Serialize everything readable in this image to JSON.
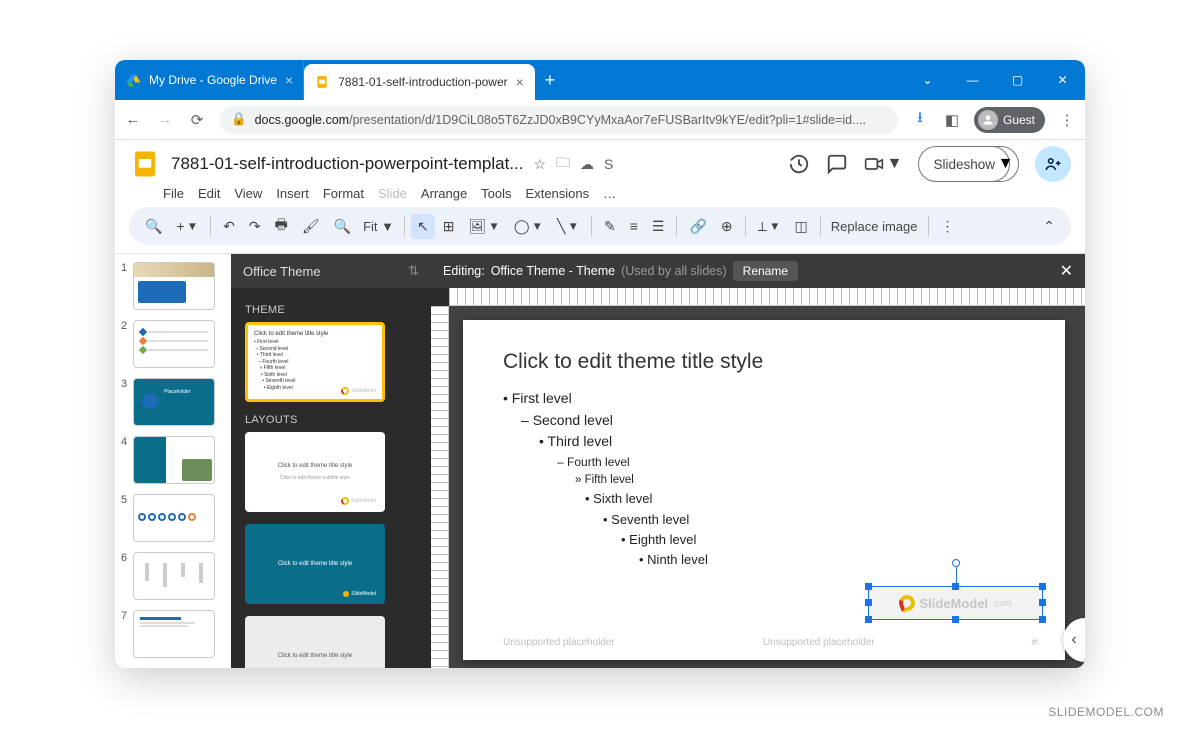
{
  "browser": {
    "tabs": [
      {
        "title": "My Drive - Google Drive",
        "favicon": "drive",
        "active": false
      },
      {
        "title": "7881-01-self-introduction-power",
        "favicon": "slides",
        "active": true
      }
    ],
    "url_host": "docs.google.com",
    "url_path": "/presentation/d/1D9CiL08o5T6ZzJD0xB9CYyMxaAor7eFUSBarItv9kYE/edit?pli=1#slide=id....",
    "guest_label": "Guest"
  },
  "app": {
    "doc_title": "7881-01-self-introduction-powerpoint-templat...",
    "s_badge": "S",
    "menus": [
      "File",
      "Edit",
      "View",
      "Insert",
      "Format",
      "Slide",
      "Arrange",
      "Tools",
      "Extensions",
      "…"
    ],
    "menu_disabled": [
      "Slide"
    ],
    "slideshow_label": "Slideshow",
    "zoom_label": "Fit",
    "replace_label": "Replace image"
  },
  "theme_panel": {
    "title": "Office Theme",
    "section_theme": "THEME",
    "section_layouts": "LAYOUTS"
  },
  "editor": {
    "prefix": "Editing:",
    "theme_name": "Office Theme - Theme",
    "used_by": "(Used by all slides)",
    "rename": "Rename"
  },
  "canvas": {
    "title": "Click to edit theme title style",
    "levels": [
      "First level",
      "Second level",
      "Third level",
      "Fourth level",
      "Fifth level",
      "Sixth level",
      "Seventh level",
      "Eighth level",
      "Ninth level"
    ],
    "ph1": "Unsupported placeholder",
    "ph2": "Unsupported placeholder",
    "page_num": "#",
    "logo_text": "SlideModel"
  },
  "slides": {
    "count": 7
  },
  "theme_thumb": {
    "title_tiny": "Click to edit theme title style",
    "subtitle_tiny": "Click to edit theme subtitle style"
  },
  "watermark": "SLIDEMODEL.COM"
}
